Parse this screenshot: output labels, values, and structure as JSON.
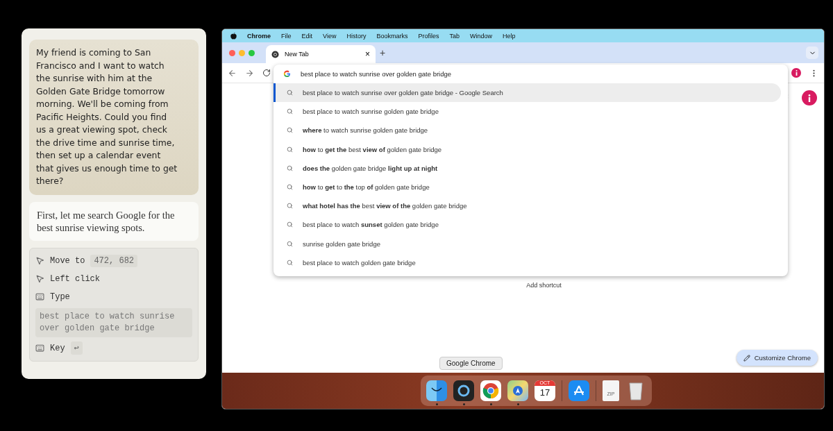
{
  "chat": {
    "user_message": "My friend is coming to San Francisco and I want to watch the sunrise with him at the Golden Gate Bridge tomorrow morning. We'll be coming from Pacific Heights. Could you find us a great viewing spot, check the drive time and sunrise time, then set up a calendar event that gives us enough time to get there?",
    "assistant_message": "First, let me search Google for the best sunrise viewing spots.",
    "actions": [
      {
        "kind": "move",
        "label": "Move to",
        "value": "472, 682"
      },
      {
        "kind": "click",
        "label": "Left click"
      },
      {
        "kind": "type",
        "label": "Type",
        "value": "best place to watch sunrise over golden gate bridge"
      },
      {
        "kind": "key",
        "label": "Key",
        "value": "↩"
      }
    ]
  },
  "menu_bar": {
    "app": "Chrome",
    "items": [
      "File",
      "Edit",
      "View",
      "History",
      "Bookmarks",
      "Profiles",
      "Tab",
      "Window",
      "Help"
    ]
  },
  "tabs": [
    {
      "title": "New Tab",
      "close": "×",
      "selected": true
    }
  ],
  "new_tab": "+",
  "omnibox": {
    "value": "best place to watch sunrise over golden gate bridge",
    "suggestions": [
      {
        "text": "best place to watch sunrise over golden gate bridge - Google Search",
        "selected": true
      },
      {
        "text": "best place to watch sunrise golden gate bridge",
        "selected": false
      },
      {
        "text": "**where** to watch sunrise golden gate bridge",
        "selected": false
      },
      {
        "text": "**how** to **get the** best **view of** golden gate bridge",
        "selected": false
      },
      {
        "text": "**does the** golden gate bridge **light up at night**",
        "selected": false
      },
      {
        "text": "**how** to **get** to **the** top **of** golden gate bridge",
        "selected": false
      },
      {
        "text": "**what hotel has the** best **view of the** golden gate bridge",
        "selected": false
      },
      {
        "text": "best place to watch **sunset** golden gate bridge",
        "selected": false
      },
      {
        "text": "sunrise golden gate bridge",
        "selected": false
      },
      {
        "text": "best place to watch golden gate bridge",
        "selected": false
      }
    ]
  },
  "page": {
    "add_shortcut": "Add shortcut",
    "customize": "Customize Chrome"
  },
  "dock": {
    "tooltip": "Google Chrome",
    "items": [
      {
        "kind": "finder",
        "running": true
      },
      {
        "kind": "quicktime",
        "running": true
      },
      {
        "kind": "chrome",
        "running": true
      },
      {
        "kind": "maps",
        "running": true
      },
      {
        "kind": "calendar",
        "running": false,
        "month": "OCT",
        "day": "17"
      },
      {
        "kind": "divider"
      },
      {
        "kind": "appstore",
        "running": false
      },
      {
        "kind": "divider"
      },
      {
        "kind": "zip",
        "running": false,
        "label": "ZIP"
      },
      {
        "kind": "trash",
        "running": false
      }
    ]
  }
}
